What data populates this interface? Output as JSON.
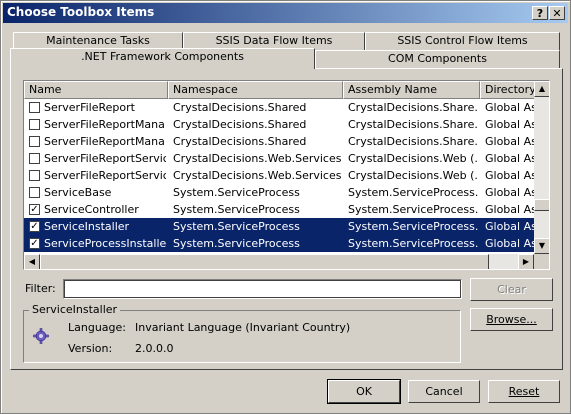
{
  "window": {
    "title": "Choose Toolbox Items",
    "help_label": "?",
    "close_label": "X"
  },
  "tabs": {
    "row1": [
      "Maintenance Tasks",
      "SSIS Data Flow Items",
      "SSIS Control Flow Items"
    ],
    "row2": [
      ".NET Framework Components",
      "COM Components"
    ],
    "active": ".NET Framework Components"
  },
  "table": {
    "columns": [
      "Name",
      "Namespace",
      "Assembly Name",
      "Directory"
    ],
    "rows": [
      {
        "checked": false,
        "selected": false,
        "name": "ServerFileReport",
        "namespace": "CrystalDecisions.Shared",
        "assembly": "CrystalDecisions.Share...",
        "directory": "Global Ass"
      },
      {
        "checked": false,
        "selected": false,
        "name": "ServerFileReportMana...",
        "namespace": "CrystalDecisions.Shared",
        "assembly": "CrystalDecisions.Share...",
        "directory": "Global Ass"
      },
      {
        "checked": false,
        "selected": false,
        "name": "ServerFileReportMana...",
        "namespace": "CrystalDecisions.Shared",
        "assembly": "CrystalDecisions.Share...",
        "directory": "Global Ass"
      },
      {
        "checked": false,
        "selected": false,
        "name": "ServerFileReportService",
        "namespace": "CrystalDecisions.Web.Services",
        "assembly": "CrystalDecisions.Web (...",
        "directory": "Global Ass"
      },
      {
        "checked": false,
        "selected": false,
        "name": "ServerFileReportService",
        "namespace": "CrystalDecisions.Web.Services",
        "assembly": "CrystalDecisions.Web (...",
        "directory": "Global Ass"
      },
      {
        "checked": false,
        "selected": false,
        "name": "ServiceBase",
        "namespace": "System.ServiceProcess",
        "assembly": "System.ServiceProcess...",
        "directory": "Global Ass"
      },
      {
        "checked": true,
        "selected": false,
        "name": "ServiceController",
        "namespace": "System.ServiceProcess",
        "assembly": "System.ServiceProcess...",
        "directory": "Global Ass"
      },
      {
        "checked": true,
        "selected": true,
        "name": "ServiceInstaller",
        "namespace": "System.ServiceProcess",
        "assembly": "System.ServiceProcess...",
        "directory": "Global Ass"
      },
      {
        "checked": true,
        "selected": true,
        "name": "ServiceProcessInstaller",
        "namespace": "System.ServiceProcess",
        "assembly": "System.ServiceProcess...",
        "directory": "Global Ass"
      }
    ]
  },
  "filter": {
    "label": "Filter:",
    "value": ""
  },
  "buttons": {
    "clear": "Clear",
    "browse": "Browse...",
    "ok": "OK",
    "cancel": "Cancel",
    "reset": "Reset"
  },
  "details": {
    "group_title": "ServiceInstaller",
    "language_label": "Language:",
    "language_value": "Invariant Language (Invariant Country)",
    "version_label": "Version:",
    "version_value": "2.0.0.0"
  },
  "icons": [
    "help-icon",
    "close-icon",
    "checkbox-icon",
    "scroll-up-icon",
    "scroll-down-icon",
    "scroll-left-icon",
    "scroll-right-icon",
    "component-gear-icon"
  ],
  "colors": {
    "title_start": "#0a246a",
    "title_end": "#a6caf0",
    "selection": "#0a246a",
    "face": "#d4d0c8"
  }
}
